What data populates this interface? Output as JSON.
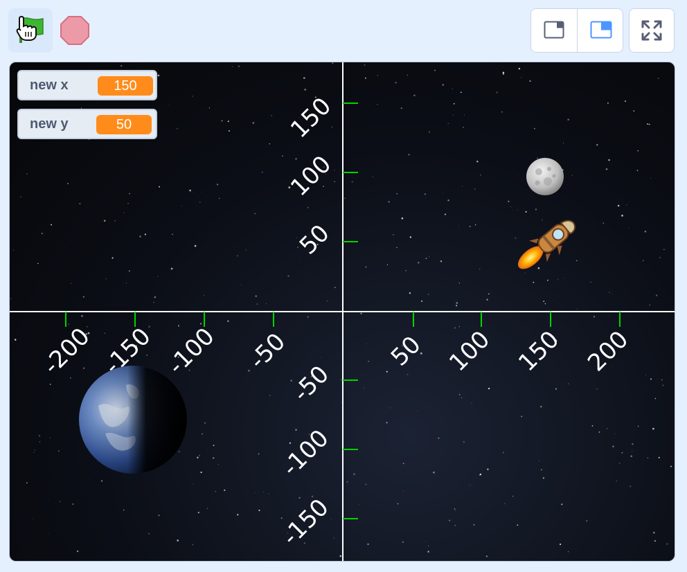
{
  "toolbar": {
    "green_flag_icon": "green-flag-icon",
    "stop_icon": "stop-sign-icon",
    "small_stage_icon": "small-stage-icon",
    "large_stage_icon": "large-stage-icon",
    "fullscreen_icon": "fullscreen-icon",
    "colors": {
      "flag": "#3fb534",
      "stop": "#e0607a",
      "active_mode": "#4c97ff"
    }
  },
  "monitors": [
    {
      "label": "new x",
      "value": "150"
    },
    {
      "label": "new y",
      "value": "50"
    }
  ],
  "stage": {
    "x_ticks": [
      "-200",
      "-150",
      "-100",
      "-50",
      "50",
      "100",
      "150",
      "200"
    ],
    "y_ticks": [
      "150",
      "100",
      "50",
      "-50",
      "-100",
      "-150"
    ],
    "sprites": [
      "moon",
      "rocket",
      "earth"
    ],
    "colors": {
      "axis": "#ffffff",
      "tick": "#00d400",
      "monitor_value": "#ff8c1a"
    }
  }
}
